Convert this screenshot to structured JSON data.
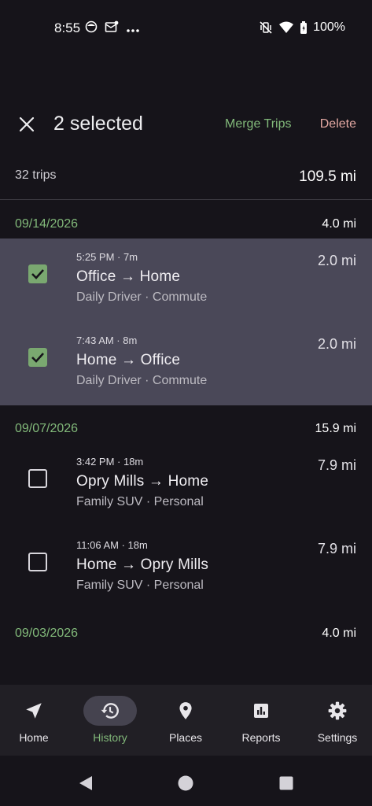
{
  "status_bar": {
    "time": "8:55",
    "battery": "100%"
  },
  "app_bar": {
    "selected_label": "2 selected",
    "merge_label": "Merge Trips",
    "delete_label": "Delete"
  },
  "summary": {
    "trips": "32 trips",
    "miles": "109.5 mi"
  },
  "groups": [
    {
      "date": "09/14/2026",
      "miles": "4.0 mi",
      "trips": [
        {
          "time": "5:25 PM  ·  7m",
          "route": "Office → Home",
          "meta": "Daily Driver  ·  Commute",
          "miles": "2.0 mi",
          "selected": true
        },
        {
          "time": "7:43 AM  ·  8m",
          "route": "Home → Office",
          "meta": "Daily Driver  ·  Commute",
          "miles": "2.0 mi",
          "selected": true
        }
      ]
    },
    {
      "date": "09/07/2026",
      "miles": "15.9 mi",
      "trips": [
        {
          "time": "3:42 PM  ·  18m",
          "route": "Opry Mills → Home",
          "meta": "Family SUV  ·  Personal",
          "miles": "7.9 mi",
          "selected": false
        },
        {
          "time": "11:06 AM  ·  18m",
          "route": "Home → Opry Mills",
          "meta": "Family SUV  ·  Personal",
          "miles": "7.9 mi",
          "selected": false
        }
      ]
    },
    {
      "date": "09/03/2026",
      "miles": "4.0 mi",
      "trips": []
    }
  ],
  "bottom_nav": [
    {
      "label": "Home",
      "icon": "navigation-arrow-icon",
      "active": false
    },
    {
      "label": "History",
      "icon": "history-icon",
      "active": true
    },
    {
      "label": "Places",
      "icon": "location-pin-icon",
      "active": false
    },
    {
      "label": "Reports",
      "icon": "bar-chart-icon",
      "active": false
    },
    {
      "label": "Settings",
      "icon": "gear-icon",
      "active": false
    }
  ],
  "colors": {
    "accent": "#82b97a",
    "delete": "#e3a8a2",
    "selected_row": "#4a4858",
    "background": "#16141a"
  }
}
